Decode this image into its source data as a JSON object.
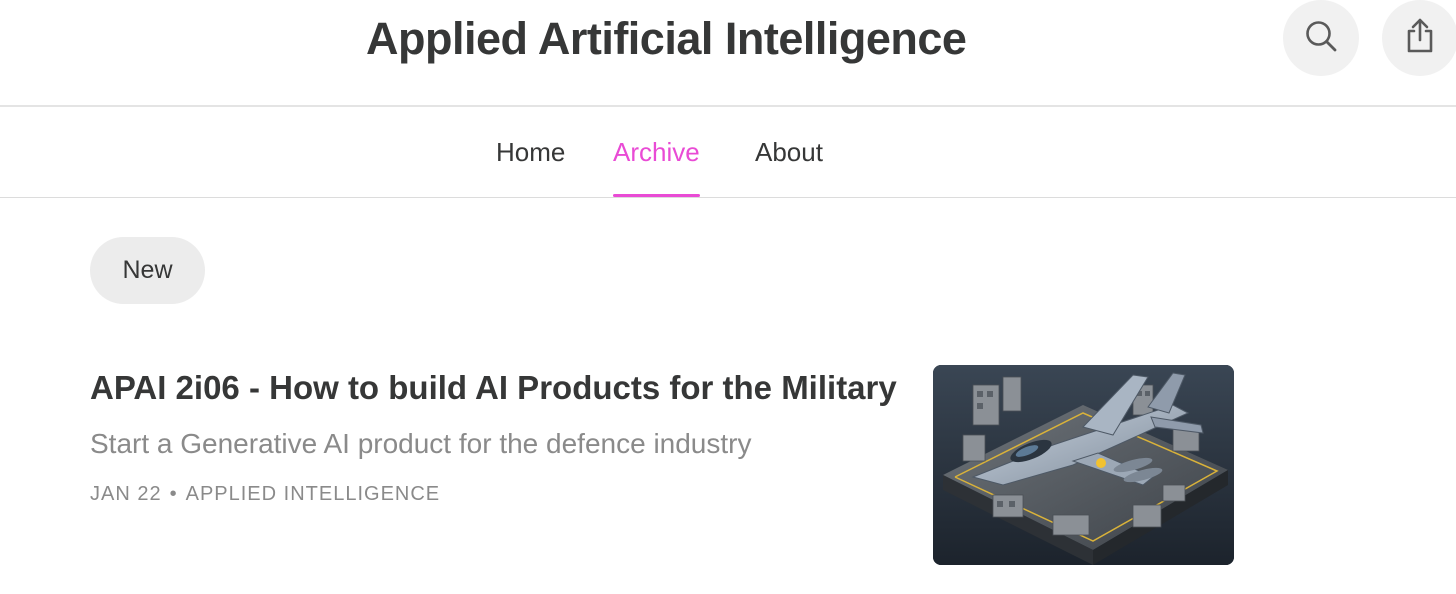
{
  "header": {
    "title": "Applied Artificial Intelligence",
    "search_icon": "search-icon",
    "share_icon": "share-icon"
  },
  "nav": {
    "tabs": [
      {
        "label": "Home",
        "active": false
      },
      {
        "label": "Archive",
        "active": true
      },
      {
        "label": "About",
        "active": false
      }
    ],
    "accent_color": "#e94bd5"
  },
  "archive": {
    "sort_label": "New"
  },
  "posts": [
    {
      "title": "APAI 2i06 - How to build AI Products for the Military",
      "subtitle": "Start a Generative AI product for the defence industry",
      "date": "JAN 22",
      "separator": "•",
      "author": "APPLIED INTELLIGENCE",
      "thumbnail": "fighter-jet-isometric-illustration"
    }
  ]
}
